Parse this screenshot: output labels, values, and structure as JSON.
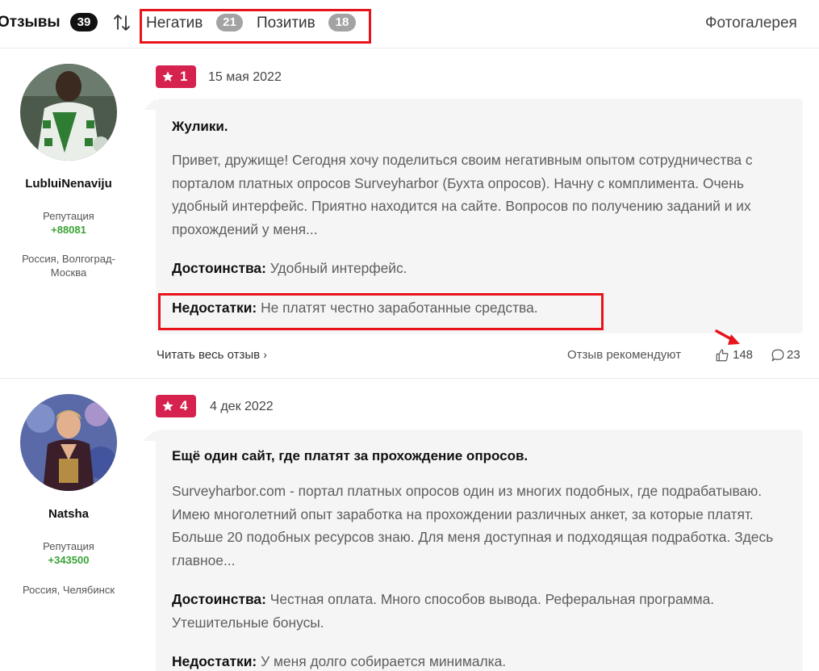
{
  "header": {
    "title": "Отзывы",
    "total_count": "39",
    "filters": [
      {
        "label": "Негатив",
        "count": "21"
      },
      {
        "label": "Позитив",
        "count": "18"
      }
    ],
    "gallery_label": "Фотогалерея"
  },
  "reviews": [
    {
      "author": {
        "name": "LubluiNenaviju",
        "rep_label": "Репутация",
        "rep_value": "+88081",
        "location": "Россия, Волгоград-Москва"
      },
      "rating": "1",
      "date": "15 мая 2022",
      "title": "Жулики.",
      "text": "Привет, дружище! Сегодня хочу поделиться своим негативным опытом сотрудничества с порталом платных опросов Surveyharbor (Бухта опросов). Начну с комплимента. Очень удобный интерфейс. Приятно находится на сайте. Вопросов по получению заданий и их прохождений у меня...",
      "pros_label": "Достоинства:",
      "pros": "Удобный интерфейс.",
      "cons_label": "Недостатки:",
      "cons": "Не платят честно заработанные средства.",
      "read_more": "Читать весь отзыв",
      "recommend_label": "Отзыв рекомендуют",
      "likes": "148",
      "comments": "23"
    },
    {
      "author": {
        "name": "Natsha",
        "rep_label": "Репутация",
        "rep_value": "+343500",
        "location": "Россия, Челябинск"
      },
      "rating": "4",
      "date": "4 дек 2022",
      "title": "Ещё один сайт, где платят за прохождение опросов.",
      "text": "Surveyharbor.com - портал платных опросов один из многих подобных, где подрабатываю. Имею многолетний опыт заработка на прохождении различных анкет, за которые платят. Больше 20 подобных ресурсов знаю. Для меня доступная и подходящая подработка. Здесь главное...",
      "pros_label": "Достоинства:",
      "pros": "Честная оплата. Много способов вывода. Реферальная программа. Утешительные бонусы.",
      "cons_label": "Недостатки:",
      "cons": "У меня долго собирается минималка."
    }
  ],
  "colors": {
    "rating_badge": "#d6224f",
    "annotation_red": "#e8141c",
    "reputation_green": "#3aa335",
    "card_bg": "#f5f5f5"
  }
}
